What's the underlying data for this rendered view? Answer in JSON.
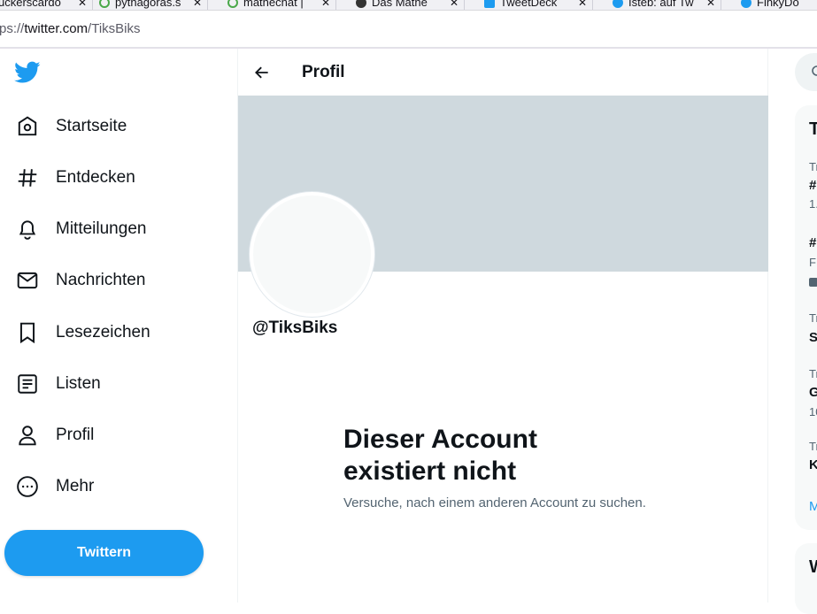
{
  "browser": {
    "tabs": [
      {
        "label": "ückerscardo",
        "icon_color": "#e44b8d"
      },
      {
        "label": "pythagoras.s",
        "icon_color": "#4aa84a"
      },
      {
        "label": "mathechat |",
        "icon_color": "#4aa84a"
      },
      {
        "label": "Das Mathe",
        "icon_color": "#333333"
      },
      {
        "label": "TweetDeck",
        "icon_color": "#1d9bf0"
      },
      {
        "label": "Isteb: auf Tw",
        "icon_color": "#1d9bf0"
      },
      {
        "label": "FinkyDo",
        "icon_color": "#1d9bf0"
      }
    ],
    "url_prefix": "ps://",
    "url_host": "twitter.com",
    "url_path": "/TiksBiks"
  },
  "nav": {
    "items": [
      {
        "label": "Startseite",
        "icon": "home-icon"
      },
      {
        "label": "Entdecken",
        "icon": "hashtag-icon"
      },
      {
        "label": "Mitteilungen",
        "icon": "bell-icon"
      },
      {
        "label": "Nachrichten",
        "icon": "mail-icon"
      },
      {
        "label": "Lesezeichen",
        "icon": "bookmark-icon"
      },
      {
        "label": "Listen",
        "icon": "list-icon"
      },
      {
        "label": "Profil",
        "icon": "person-icon"
      },
      {
        "label": "Mehr",
        "icon": "more-circle-icon"
      }
    ],
    "tweet_button": "Twittern"
  },
  "main": {
    "header_title": "Profil",
    "handle": "@TiksBiks",
    "empty_title": "Dieser Account existiert nicht",
    "empty_subtitle": "Versuche, nach einem anderen Account zu suchen."
  },
  "right": {
    "trends_heading": "T",
    "trend_rows": [
      {
        "meta": "Tr",
        "name": "#",
        "extra": "1."
      },
      {
        "meta": "",
        "name": "#",
        "extra": "F"
      },
      {
        "meta": "Tr",
        "name": "S",
        "extra": ""
      },
      {
        "meta": "Tr",
        "name": "G",
        "extra": "10"
      },
      {
        "meta": "Tr",
        "name": "K",
        "extra": ""
      }
    ],
    "more_link": "M",
    "who_heading": "W"
  },
  "colors": {
    "accent": "#1d9bf0",
    "banner": "#cfd9de",
    "text": "#0f1419",
    "muted": "#536471"
  }
}
